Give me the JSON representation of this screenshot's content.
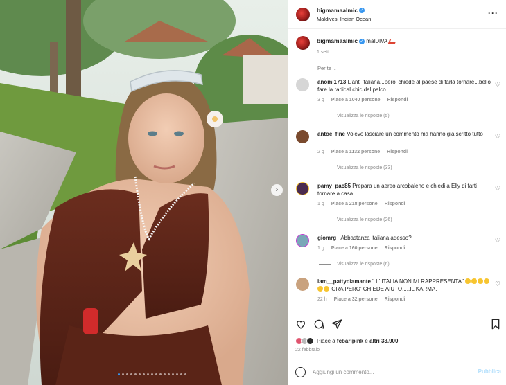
{
  "post": {
    "username": "bigmamaalmic",
    "location": "Maldives, Indian Ocean",
    "caption": "malDIVA",
    "caption_time": "1 sett",
    "translate_label": "Per te",
    "more_icon": "ellipsis-icon"
  },
  "comments": [
    {
      "user": "anomi1713",
      "text": "L'anti italiana...pero' chiede al paese di farla tornare...bello fare la radical chic dal palco",
      "time": "3 g",
      "likes": "Piace a 1040 persone",
      "reply_label": "Rispondi",
      "view_replies": "Visualizza le risposte (5)",
      "avatar_color": "#d6d6d6"
    },
    {
      "user": "antoe_fine",
      "text": "Volevo lasciare un commento ma hanno già scritto tutto",
      "time": "2 g",
      "likes": "Piace a 1132 persone",
      "reply_label": "Rispondi",
      "view_replies": "Visualizza le risposte (33)",
      "avatar_color": "#7a4a2e"
    },
    {
      "user": "pamy_pac85",
      "text": "Prepara un aereo arcobaleno e chiedi a Elly di farti tornare a casa.",
      "time": "1 g",
      "likes": "Piace a 218 persone",
      "reply_label": "Rispondi",
      "view_replies": "Visualizza le risposte (26)",
      "avatar_color": "#4b2b4f"
    },
    {
      "user": "giomrg_",
      "text": "Abbastanza italiana adesso?",
      "time": "1 g",
      "likes": "Piace a 160 persone",
      "reply_label": "Rispondi",
      "view_replies": "Visualizza le risposte (6)",
      "avatar_color": "#7aa7b8"
    },
    {
      "user": "iam__pattydiamante",
      "text_a": "\" L' ITALIA NON MI RAPPRESENTA\"",
      "text_b": "ORA PERO' CHIEDE AIUTO.....IL KARMA.",
      "time": "22 h",
      "likes": "Piace a 32 persone",
      "reply_label": "Rispondi",
      "avatar_color": "#c9a27e"
    }
  ],
  "actions": {
    "liked_by_prefix": "Piace a",
    "liked_by_user": "fcbaripink",
    "liked_by_and": "e",
    "liked_by_others": "altri 33.900",
    "date": "22 febbraio"
  },
  "composer": {
    "placeholder": "Aggiungi un commento...",
    "publish_label": "Pubblica"
  },
  "colors": {
    "verified": "#3897f0",
    "secondary_text": "#8e8e8e",
    "publish_disabled": "#b2dffc"
  }
}
